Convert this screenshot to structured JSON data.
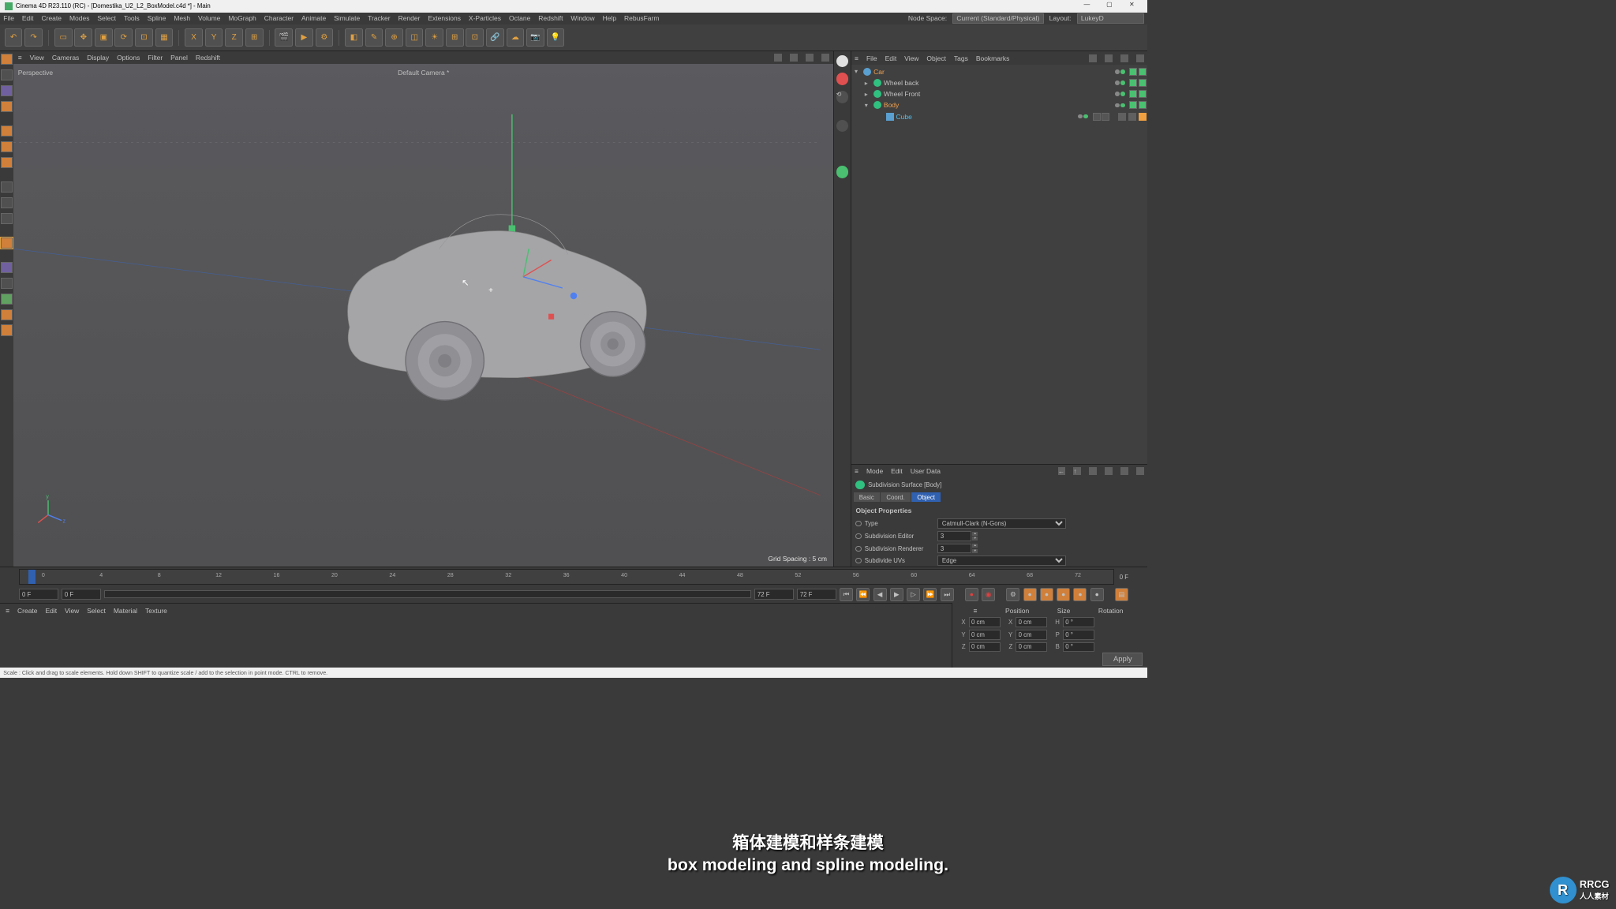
{
  "title": "Cinema 4D R23.110 (RC) - [Domestika_U2_L2_BoxModel.c4d *] - Main",
  "window_buttons": {
    "min": "—",
    "max": "▢",
    "close": "✕"
  },
  "menubar": [
    "File",
    "Edit",
    "Create",
    "Modes",
    "Select",
    "Tools",
    "Spline",
    "Mesh",
    "Volume",
    "MoGraph",
    "Character",
    "Animate",
    "Simulate",
    "Tracker",
    "Render",
    "Extensions",
    "X-Particles",
    "Octane",
    "Redshift",
    "Window",
    "Help",
    "RebusFarm"
  ],
  "menubar_right": {
    "node_space_label": "Node Space:",
    "node_space_value": "Current (Standard/Physical)",
    "layout_label": "Layout:",
    "layout_value": "LukeyD"
  },
  "viewport_menus": [
    "View",
    "Cameras",
    "Display",
    "Options",
    "Filter",
    "Panel",
    "Redshift"
  ],
  "viewport": {
    "perspective_label": "Perspective",
    "camera_label": "Default Camera *",
    "grid_label": "Grid Spacing : 5 cm"
  },
  "object_panel": {
    "menus": [
      "File",
      "Edit",
      "View",
      "Object",
      "Tags",
      "Bookmarks"
    ],
    "hierarchy": [
      {
        "name": "Car",
        "depth": 0,
        "icon": "null",
        "expand": "-",
        "sel": "orange"
      },
      {
        "name": "Wheel back",
        "depth": 1,
        "icon": "sds",
        "expand": "+"
      },
      {
        "name": "Wheel Front",
        "depth": 1,
        "icon": "sds",
        "expand": "+"
      },
      {
        "name": "Body",
        "depth": 1,
        "icon": "sds",
        "expand": "-",
        "sel": "orange"
      },
      {
        "name": "Cube",
        "depth": 2,
        "icon": "cube",
        "expand": "",
        "sel": "blue",
        "tags": true
      }
    ]
  },
  "attr_panel": {
    "menus": [
      "Mode",
      "Edit",
      "User Data"
    ],
    "header": "Subdivision Surface [Body]",
    "tabs": [
      "Basic",
      "Coord.",
      "Object"
    ],
    "active_tab": 2,
    "section": "Object Properties",
    "rows": {
      "type_label": "Type",
      "type_value": "Catmull-Clark (N-Gons)",
      "editor_label": "Subdivision Editor",
      "editor_value": "3",
      "renderer_label": "Subdivision Renderer",
      "renderer_value": "3",
      "uv_label": "Subdivide UVs",
      "uv_value": "Edge"
    }
  },
  "timeline": {
    "ticks": [
      "0",
      "4",
      "8",
      "12",
      "16",
      "20",
      "24",
      "28",
      "32",
      "36",
      "40",
      "44",
      "48",
      "52",
      "56",
      "60",
      "64",
      "68",
      "72"
    ],
    "end_label": "0 F",
    "start_frame": "0 F",
    "range_start": "0 F",
    "current_frame": "72 F",
    "range_end": "72 F"
  },
  "material_menus": [
    "Create",
    "Edit",
    "View",
    "Select",
    "Material",
    "Texture"
  ],
  "coord": {
    "headers": [
      "Position",
      "Size",
      "Rotation"
    ],
    "x": {
      "pos": "0 cm",
      "size": "0 cm",
      "rot_lbl": "H",
      "rot": "0 °"
    },
    "y": {
      "pos": "0 cm",
      "size": "0 cm",
      "rot_lbl": "P",
      "rot": "0 °"
    },
    "z": {
      "pos": "0 cm",
      "size": "0 cm",
      "rot_lbl": "B",
      "rot": "0 °"
    },
    "apply": "Apply"
  },
  "subtitle": {
    "cn": "箱体建模和样条建模",
    "en": "box modeling and spline modeling."
  },
  "watermark": {
    "line1": "RRCG",
    "line2": "人人素材"
  },
  "statusbar": "Scale : Click and drag to scale elements. Hold down SHIFT to quantize scale / add to the selection in point mode. CTRL to remove."
}
